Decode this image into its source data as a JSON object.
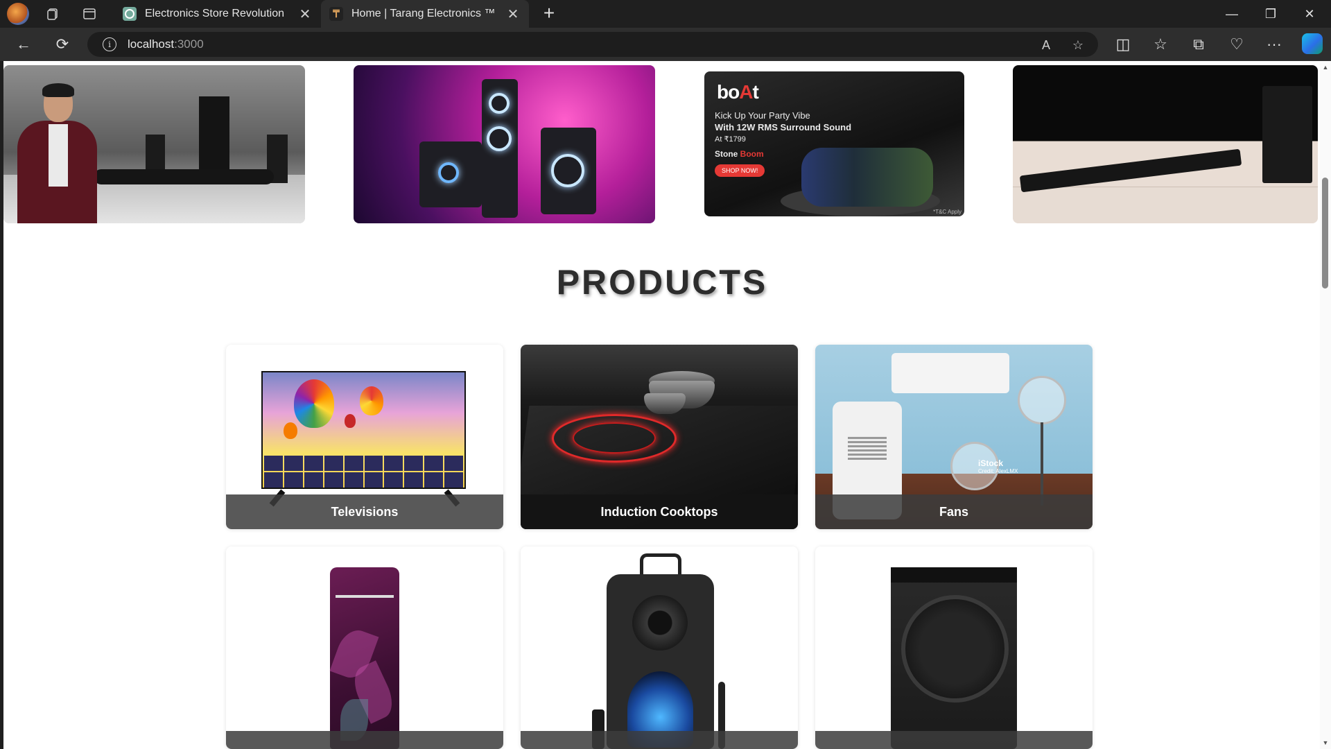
{
  "browser": {
    "tabs": [
      {
        "title": "Electronics Store Revolution",
        "favicon": "chatgpt-icon",
        "active": false
      },
      {
        "title": "Home | Tarang Electronics ™",
        "favicon": "tarang-icon",
        "active": true
      }
    ],
    "address": {
      "host": "localhost",
      "port": ":3000"
    },
    "icons": {
      "back": "←",
      "reload": "⟳",
      "newtab": "+",
      "close_tab": "✕",
      "minimize": "—",
      "restore": "❐",
      "close": "✕",
      "info": "i",
      "read_aloud": "A",
      "favorite": "☆",
      "split": "◫",
      "favorites": "☆",
      "collections": "⧉",
      "performance": "♡",
      "more": "···"
    }
  },
  "banners": {
    "b3": {
      "logo_pre": "bo",
      "logo_accent": "A",
      "logo_post": "t",
      "line1": "Kick Up Your Party Vibe",
      "line2": "With 12W RMS Surround Sound",
      "line3": "At ₹1799",
      "line4_pre": "Stone ",
      "line4_accent": "Boom",
      "cta": "SHOP NOW!",
      "tnc": "*T&C Apply"
    }
  },
  "products": {
    "title": "PRODUCTS",
    "items": [
      {
        "label": "Televisions"
      },
      {
        "label": "Induction Cooktops"
      },
      {
        "label": "Fans"
      }
    ],
    "watermark": {
      "brand": "iStock",
      "credit": "Credit: AlexLMX"
    }
  },
  "colors": {
    "accent_red": "#e53935",
    "page_bg": "#ffffff",
    "chrome_bg": "#1f1f1f"
  }
}
